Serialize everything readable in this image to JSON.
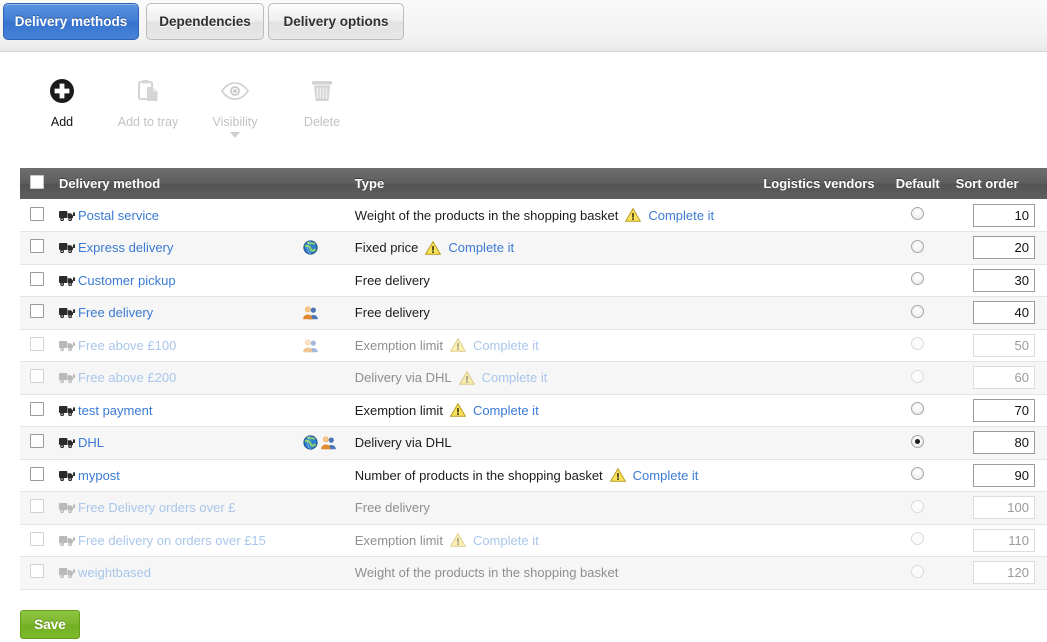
{
  "tabs": [
    {
      "id": "delivery-methods",
      "label": "Delivery methods",
      "active": true
    },
    {
      "id": "dependencies",
      "label": "Dependencies",
      "active": false
    },
    {
      "id": "delivery-options",
      "label": "Delivery options",
      "active": false
    }
  ],
  "toolbar": [
    {
      "id": "add",
      "label": "Add",
      "icon": "plus-circle-icon",
      "enabled": true,
      "caret": false
    },
    {
      "id": "add-to-tray",
      "label": "Add to tray",
      "icon": "clipboard-icon",
      "enabled": false,
      "caret": false
    },
    {
      "id": "visibility",
      "label": "Visibility",
      "icon": "eye-icon",
      "enabled": false,
      "caret": true
    },
    {
      "id": "delete",
      "label": "Delete",
      "icon": "trash-icon",
      "enabled": false,
      "caret": false
    }
  ],
  "table": {
    "columns": {
      "delivery_method": "Delivery method",
      "type": "Type",
      "logistics_vendors": "Logistics vendors",
      "default": "Default",
      "sort_order": "Sort order"
    },
    "rows": [
      {
        "name": "Postal service",
        "type": "Weight of the products in the shopping basket",
        "complete": "Complete it",
        "warn": true,
        "globe": false,
        "people": false,
        "default": false,
        "sort": "10",
        "disabled": false
      },
      {
        "name": "Express delivery",
        "type": "Fixed price",
        "complete": "Complete it",
        "warn": true,
        "globe": true,
        "people": false,
        "default": false,
        "sort": "20",
        "disabled": false
      },
      {
        "name": "Customer pickup",
        "type": "Free delivery",
        "complete": "",
        "warn": false,
        "globe": false,
        "people": false,
        "default": false,
        "sort": "30",
        "disabled": false
      },
      {
        "name": "Free delivery",
        "type": "Free delivery",
        "complete": "",
        "warn": false,
        "globe": false,
        "people": true,
        "default": false,
        "sort": "40",
        "disabled": false
      },
      {
        "name": "Free above £100",
        "type": "Exemption limit",
        "complete": "Complete it",
        "warn": true,
        "globe": false,
        "people": true,
        "default": false,
        "sort": "50",
        "disabled": true
      },
      {
        "name": "Free above £200",
        "type": "Delivery via DHL",
        "complete": "Complete it",
        "warn": true,
        "globe": false,
        "people": false,
        "default": false,
        "sort": "60",
        "disabled": true
      },
      {
        "name": "test payment",
        "type": "Exemption limit",
        "complete": "Complete it",
        "warn": true,
        "globe": false,
        "people": false,
        "default": false,
        "sort": "70",
        "disabled": false
      },
      {
        "name": "DHL",
        "type": "Delivery via DHL",
        "complete": "",
        "warn": false,
        "globe": true,
        "people": true,
        "default": true,
        "sort": "80",
        "disabled": false
      },
      {
        "name": "mypost",
        "type": "Number of products in the shopping basket",
        "complete": "Complete it",
        "warn": true,
        "globe": false,
        "people": false,
        "default": false,
        "sort": "90",
        "disabled": false
      },
      {
        "name": "Free Delivery orders over £",
        "type": "Free delivery",
        "complete": "",
        "warn": false,
        "globe": false,
        "people": false,
        "default": false,
        "sort": "100",
        "disabled": true
      },
      {
        "name": "Free delivery on orders over £15",
        "type": "Exemption limit",
        "complete": "Complete it",
        "warn": true,
        "globe": false,
        "people": false,
        "default": false,
        "sort": "110",
        "disabled": true
      },
      {
        "name": "weightbased",
        "type": "Weight of the products in the shopping basket",
        "complete": "",
        "warn": false,
        "globe": false,
        "people": false,
        "default": false,
        "sort": "120",
        "disabled": true
      }
    ]
  },
  "save": {
    "label": "Save"
  },
  "colors": {
    "accent_blue": "#3a7ad4",
    "link_blue": "#3a7ad4",
    "link_blue_disabled": "#a9c6ec",
    "header_gray": "#5e5e5e",
    "save_green": "#7db72e",
    "warning_yellow": "#f2c832"
  }
}
